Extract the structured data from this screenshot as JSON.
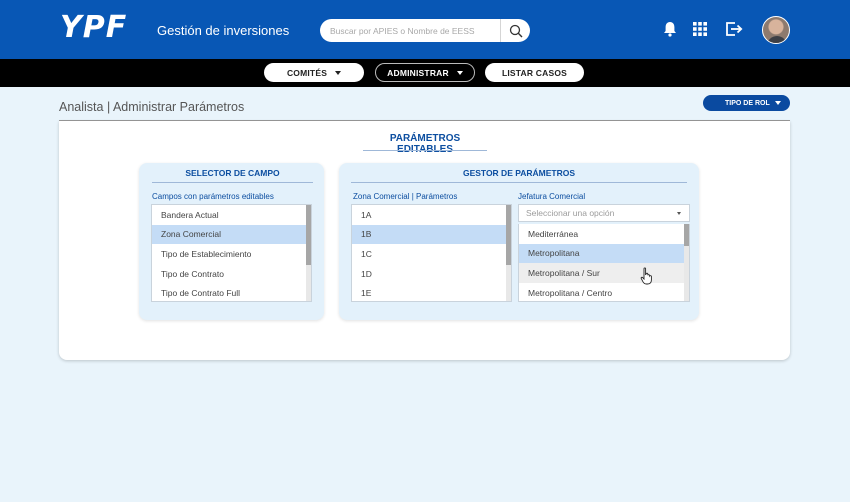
{
  "header": {
    "brand": "YPF",
    "app_title": "Gestión de inversiones",
    "search_placeholder": "Buscar por APIES o Nombre de EESS",
    "icons": [
      "search-icon",
      "bell-icon",
      "apps-grid-icon",
      "logout-icon"
    ],
    "colors": {
      "header_bg": "#0857b5",
      "nav_bg": "#000000",
      "accent": "#0c4ea0",
      "selection": "#c4dcf6"
    }
  },
  "nav": {
    "items": [
      {
        "label": "COMITÉS",
        "has_dropdown": true
      },
      {
        "label": "ADMINISTRAR",
        "has_dropdown": true,
        "active": true
      },
      {
        "label": "LISTAR CASOS",
        "has_dropdown": false
      }
    ]
  },
  "breadcrumb": "Analista | Administrar Parámetros",
  "role_button": "TIPO DE ROL",
  "main": {
    "title": "PARÁMETROS EDITABLES",
    "selector": {
      "title": "SELECTOR DE CAMPO",
      "list_label": "Campos con parámetros editables",
      "items": [
        "Bandera Actual",
        "Zona Comercial",
        "Tipo de Establecimiento",
        "Tipo de Contrato",
        "Tipo de Contrato Full"
      ],
      "selected": "Zona Comercial"
    },
    "manager": {
      "title": "GESTOR DE PARÁMETROS",
      "list_label": "Zona Comercial | Parámetros",
      "items": [
        "1A",
        "1B",
        "1C",
        "1D",
        "1E"
      ],
      "selected": "1B",
      "field_label": "Jefatura Comercial",
      "select_placeholder": "Seleccionar una opción",
      "options": [
        "Mediterránea",
        "Metropolitana",
        "Metropolitana / Sur",
        "Metropolitana / Centro"
      ],
      "selected_option": "Metropolitana"
    }
  }
}
